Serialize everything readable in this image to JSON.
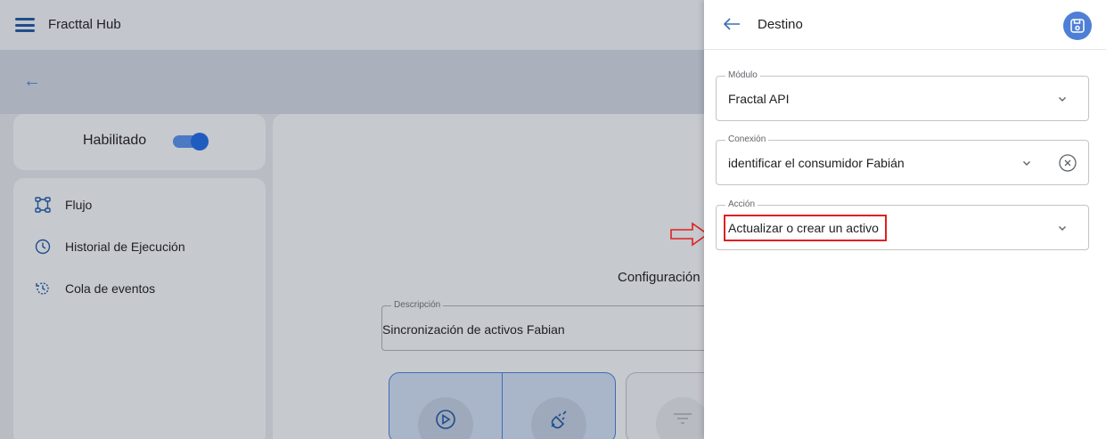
{
  "app": {
    "title": "Fracttal Hub"
  },
  "sidebar": {
    "enabled_label": "Habilitado",
    "enabled": true,
    "items": [
      {
        "label": "Flujo",
        "icon": "flow-icon"
      },
      {
        "label": "Historial de Ejecución",
        "icon": "clock-icon"
      },
      {
        "label": "Cola de eventos",
        "icon": "history-icon"
      }
    ]
  },
  "main": {
    "config_label": "Configuración",
    "description": {
      "label": "Descripción",
      "value": "Sincronización de activos Fabian"
    }
  },
  "drawer": {
    "title": "Destino",
    "modulo": {
      "label": "Módulo",
      "value": "Fractal API"
    },
    "conexion": {
      "label": "Conexión",
      "value": "identificar el consumidor Fabián"
    },
    "accion": {
      "label": "Acción",
      "value": "Actualizar o crear un activo"
    }
  },
  "colors": {
    "accent": "#4d7fd6",
    "highlight": "#e02020"
  }
}
